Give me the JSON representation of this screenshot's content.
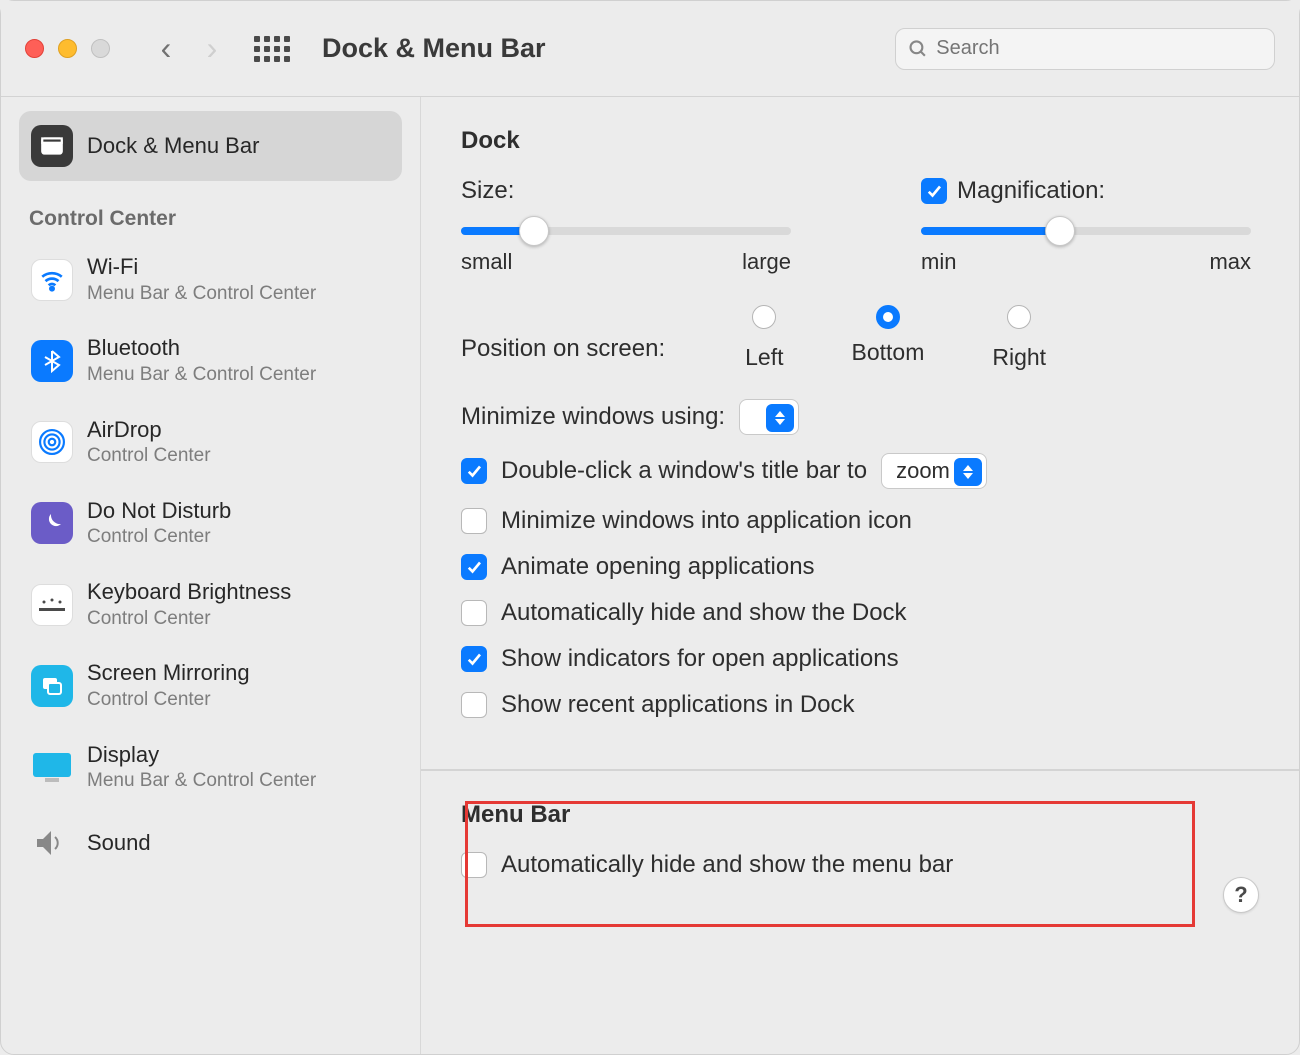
{
  "window": {
    "title": "Dock & Menu Bar"
  },
  "search": {
    "placeholder": "Search"
  },
  "sidebar": {
    "section_control_center": "Control Center",
    "items": [
      {
        "title": "Dock & Menu Bar",
        "sub": ""
      },
      {
        "title": "Wi-Fi",
        "sub": "Menu Bar & Control Center"
      },
      {
        "title": "Bluetooth",
        "sub": "Menu Bar & Control Center"
      },
      {
        "title": "AirDrop",
        "sub": "Control Center"
      },
      {
        "title": "Do Not Disturb",
        "sub": "Control Center"
      },
      {
        "title": "Keyboard Brightness",
        "sub": "Control Center"
      },
      {
        "title": "Screen Mirroring",
        "sub": "Control Center"
      },
      {
        "title": "Display",
        "sub": "Menu Bar & Control Center"
      },
      {
        "title": "Sound",
        "sub": ""
      }
    ]
  },
  "dock": {
    "heading": "Dock",
    "size_label": "Size:",
    "size_min": "small",
    "size_max": "large",
    "mag_label": "Magnification:",
    "mag_min": "min",
    "mag_max": "max",
    "pos_label": "Position on screen:",
    "pos_left": "Left",
    "pos_bottom": "Bottom",
    "pos_right": "Right",
    "minimize_label": "Minimize windows using:",
    "minimize_value": "",
    "dblclick_label": "Double-click a window's title bar to",
    "dblclick_value": "zoom",
    "cb_minimize_into": "Minimize windows into application icon",
    "cb_animate": "Animate opening applications",
    "cb_autohide_dock": "Automatically hide and show the Dock",
    "cb_indicators": "Show indicators for open applications",
    "cb_recent": "Show recent applications in Dock"
  },
  "menubar": {
    "heading": "Menu Bar",
    "cb_autohide": "Automatically hide and show the menu bar"
  },
  "help": "?"
}
